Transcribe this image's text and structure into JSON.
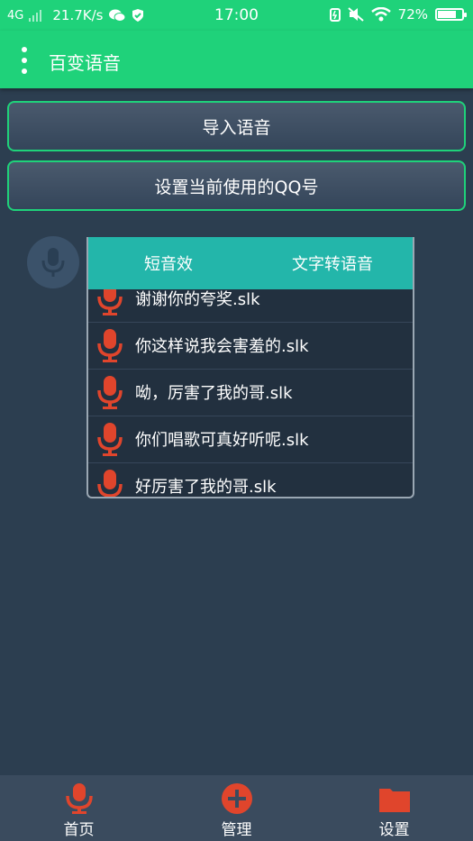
{
  "status": {
    "network": "4G",
    "speed": "21.7K/s",
    "time": "17:00",
    "battery": "72%",
    "battery_level": 0.72
  },
  "appbar": {
    "title": "百变语音"
  },
  "buttons": {
    "import_voice": "导入语音",
    "set_qq": "设置当前使用的QQ号"
  },
  "popup": {
    "tabs": [
      "短音效",
      "文字转语音"
    ],
    "items": [
      "谢谢你的夸奖.slk",
      "你这样说我会害羞的.slk",
      "呦，厉害了我的哥.slk",
      "你们唱歌可真好听呢.slk",
      "好厉害了我的哥.slk"
    ]
  },
  "nav": {
    "home": "首页",
    "manage": "管理",
    "settings": "设置"
  },
  "colors": {
    "accent": "#1fd27a",
    "tab_bar": "#23b6aa",
    "mic_red": "#e0452c",
    "background": "#2c3e50"
  }
}
